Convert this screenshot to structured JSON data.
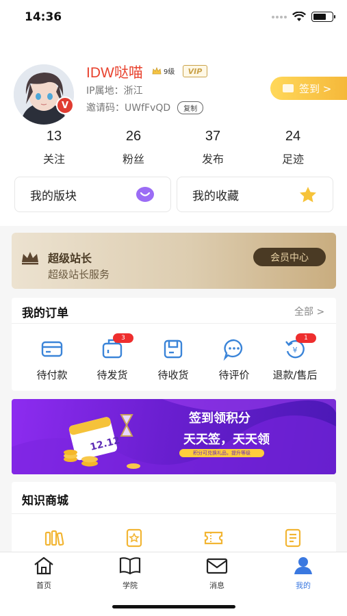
{
  "status": {
    "time": "14:36"
  },
  "profile": {
    "username": "IDW哒喵",
    "level": "9级",
    "vip": "VIP",
    "avatar_badge": "V",
    "ip": "IP属地：浙江",
    "invite": "邀请码：UWfFvQD",
    "copy_label": "复制",
    "signin_label": "签到 >"
  },
  "stats": [
    {
      "num": "13",
      "label": "关注"
    },
    {
      "num": "26",
      "label": "粉丝"
    },
    {
      "num": "37",
      "label": "发布"
    },
    {
      "num": "24",
      "label": "足迹"
    }
  ],
  "quick": {
    "my_sections": "我的版块",
    "my_favorites": "我的收藏"
  },
  "vip_banner": {
    "title": "超级站长",
    "subtitle": "超级站长服务",
    "button": "会员中心"
  },
  "orders": {
    "title": "我的订单",
    "all": "全部 >",
    "items": [
      {
        "label": "待付款",
        "badge": ""
      },
      {
        "label": "待发货",
        "badge": "3"
      },
      {
        "label": "待收货",
        "badge": ""
      },
      {
        "label": "待评价",
        "badge": ""
      },
      {
        "label": "退款/售后",
        "badge": "1"
      }
    ]
  },
  "promo": {
    "title": "签到领积分",
    "slogan": "天天签，天天领",
    "sub": "积分可兑换礼品，提升等级",
    "calendar_text": "12.12"
  },
  "shop": {
    "title": "知识商城"
  },
  "tabs": [
    {
      "label": "首页",
      "icon": "home-icon"
    },
    {
      "label": "学院",
      "icon": "book-icon"
    },
    {
      "label": "消息",
      "icon": "mail-icon"
    },
    {
      "label": "我的",
      "icon": "user-icon"
    }
  ],
  "colors": {
    "accent": "#3a78e0",
    "username": "#e8432f",
    "signin": "#f5b83a",
    "promo_start": "#8d2cf0",
    "promo_end": "#4a18b5"
  }
}
